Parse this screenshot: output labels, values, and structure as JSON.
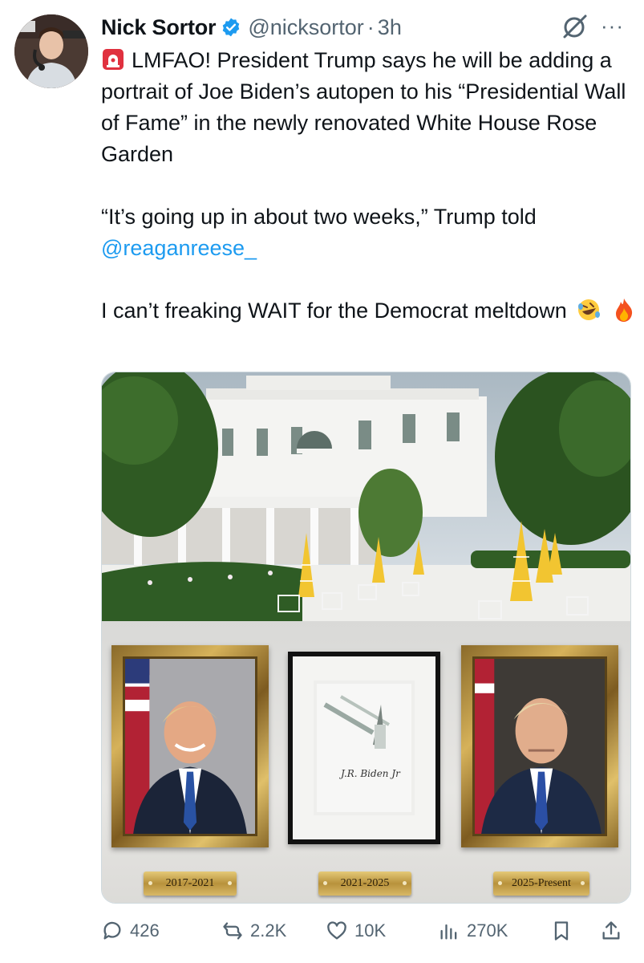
{
  "post": {
    "author_name": "Nick Sortor",
    "handle": "@nicksortor",
    "separator": "·",
    "time": "3h",
    "more_label": "···",
    "text_line1_rest": "LMFAO! President Trump says he will be adding a portrait of Joe Biden’s autopen to his “Presidential Wall of Fame” in the newly renovated White House Rose Garden",
    "text_quote": "“It’s going up in about two weeks,” Trump told",
    "mention": "@reaganreese_",
    "text_end": "I can’t freaking WAIT for the Democrat meltdown"
  },
  "media": {
    "plaques": [
      "2017-2021",
      "2021-2025",
      "2025-Present"
    ],
    "signature": "J.R. Biden Jr"
  },
  "actions": {
    "replies": "426",
    "reposts": "2.2K",
    "likes": "10K",
    "views": "270K"
  },
  "colors": {
    "link": "#1d9bf0",
    "muted": "#536471",
    "verified": "#1d9bf0"
  },
  "icons": [
    "siren-emoji",
    "verified-badge-icon",
    "grok-icon",
    "more-icon",
    "rofl-emoji",
    "fire-emoji",
    "reply-icon",
    "repost-icon",
    "like-icon",
    "views-icon",
    "bookmark-icon",
    "share-icon"
  ]
}
